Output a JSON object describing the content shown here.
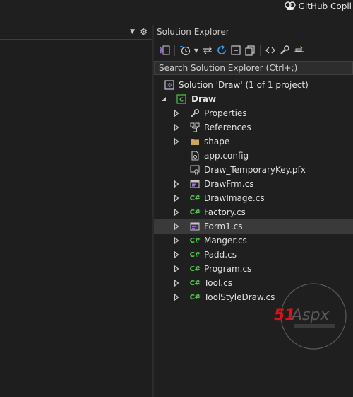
{
  "topbar": {
    "copilot_label": "GitHub Copil",
    "copilot_icon": "copilot-icon"
  },
  "solution_explorer": {
    "title": "Solution Explorer",
    "search_placeholder": "Search Solution Explorer (Ctrl+;)",
    "toolbar_icons": [
      "vs-switch-views-icon",
      "pending-changes-icon",
      "sync-with-active-document-icon",
      "refresh-icon",
      "collapse-all-icon",
      "show-all-files-icon",
      "view-code-icon",
      "properties-icon",
      "preview-selected-items-icon"
    ],
    "tree": {
      "solution_label": "Solution 'Draw' (1 of 1 project)",
      "project_label": "Draw",
      "items": [
        {
          "label": "Properties",
          "icon": "wrench-icon",
          "expandable": true
        },
        {
          "label": "References",
          "icon": "references-icon",
          "expandable": true
        },
        {
          "label": "shape",
          "icon": "folder-icon",
          "expandable": true
        },
        {
          "label": "app.config",
          "icon": "config-file-icon",
          "expandable": false
        },
        {
          "label": "Draw_TemporaryKey.pfx",
          "icon": "certificate-icon",
          "expandable": false
        },
        {
          "label": "DrawFrm.cs",
          "icon": "form-icon",
          "expandable": true
        },
        {
          "label": "DrawImage.cs",
          "icon": "csharp-file-icon",
          "expandable": true
        },
        {
          "label": "Factory.cs",
          "icon": "csharp-file-icon",
          "expandable": true
        },
        {
          "label": "Form1.cs",
          "icon": "form-icon",
          "expandable": true,
          "selected": true
        },
        {
          "label": "Manger.cs",
          "icon": "csharp-file-icon",
          "expandable": true
        },
        {
          "label": "Padd.cs",
          "icon": "csharp-file-icon",
          "expandable": true
        },
        {
          "label": "Program.cs",
          "icon": "csharp-file-icon",
          "expandable": true
        },
        {
          "label": "Tool.cs",
          "icon": "csharp-file-icon",
          "expandable": true
        },
        {
          "label": "ToolStyleDraw.cs",
          "icon": "csharp-file-icon",
          "expandable": true
        }
      ]
    }
  },
  "watermark": {
    "logo_text": "51Aspx"
  },
  "colors": {
    "background": "#1f1f1f",
    "csharp_icon": "#4ec94e",
    "selected_row": "#3a3a3a",
    "refresh_icon": "#3c9cf0",
    "watermark_red": "#e0101a"
  }
}
